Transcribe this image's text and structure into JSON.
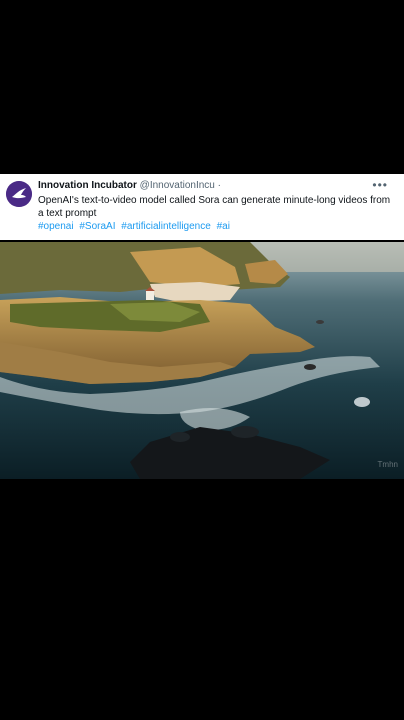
{
  "tweet": {
    "author_name": "Innovation Incubator",
    "handle": "@InnovationIncu ·",
    "more_label": "•••",
    "text": "OpenAI's text-to-video model called Sora can generate minute-long videos from a text prompt",
    "hashtags": [
      "#openai",
      "#SoraAI",
      "#artificialintelligence",
      "#ai"
    ]
  },
  "video": {
    "watermark": "Tmhn"
  },
  "colors": {
    "background": "#000000",
    "link": "#1d9bf0",
    "avatar": "#4a2a86"
  },
  "icons": {
    "avatar": "bird-logo-icon"
  }
}
